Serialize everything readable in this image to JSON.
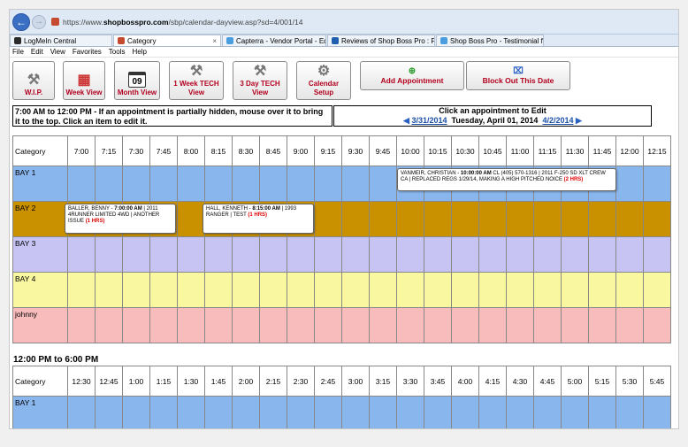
{
  "browser": {
    "url_prefix": "https://www.",
    "url_host": "shopbosspro.com",
    "url_path": "/sbp/calendar-dayview.asp?sd=4/001/14",
    "tabs": [
      {
        "label": "LogMeIn Central",
        "color": "#2b2b2b"
      },
      {
        "label": "Category",
        "color": "#c54a2f",
        "active": true
      },
      {
        "label": "Capterra - Vendor Portal - Edit...",
        "color": "#4a9ee0"
      },
      {
        "label": "Reviews of Shop Boss Pro : Fre...",
        "color": "#1f5fb0"
      },
      {
        "label": "Shop Boss Pro - Testimonial fr...",
        "color": "#4a9ee0"
      }
    ],
    "menu": [
      "File",
      "Edit",
      "View",
      "Favorites",
      "Tools",
      "Help"
    ]
  },
  "toolbar": {
    "wip": "W.I.P.",
    "week_view": "Week View",
    "month_view": "Month View",
    "month_day": "09",
    "one_week_tech_1": "1 Week TECH",
    "one_week_tech_2": "View",
    "three_day_tech_1": "3 Day TECH",
    "three_day_tech_2": "View",
    "calendar_setup_1": "Calendar",
    "calendar_setup_2": "Setup",
    "add_appointment": "Add Appointment",
    "block_out": "Block Out This Date"
  },
  "info": {
    "left_text": "7:00 AM to 12:00 PM - If an appointment is partially hidden, mouse over it to bring it to the top.  Click an item to edit it.",
    "right_title": "Click an appointment to Edit",
    "prev_date": "3/31/2014",
    "current_date": "Tuesday, April 01, 2014",
    "next_date": "4/2/2014"
  },
  "grid1": {
    "category_label": "Category",
    "times": [
      "7:00",
      "7:15",
      "7:30",
      "7:45",
      "8:00",
      "8:15",
      "8:30",
      "8:45",
      "9:00",
      "9:15",
      "9:30",
      "9:45",
      "10:00",
      "10:15",
      "10:30",
      "10:45",
      "11:00",
      "11:15",
      "11:30",
      "11:45",
      "12:00",
      "12:15"
    ],
    "rows": [
      {
        "label": "BAY 1",
        "cls": "bay1"
      },
      {
        "label": "BAY 2",
        "cls": "bay2"
      },
      {
        "label": "BAY 3",
        "cls": "bay3"
      },
      {
        "label": "BAY 4",
        "cls": "bay4"
      },
      {
        "label": "johnny",
        "cls": "johnny"
      }
    ]
  },
  "appointments": [
    {
      "name": "VANMEIR, CHRISTIAN",
      "time": "10:00:00 AM",
      "rest": "CL (405) 570-1316  | 2011 F-250 SD XLT CREW CA | REPLACED REGS 1/29/14, MAKING A HIGH PITCHED NOICE",
      "hrs": "(2 HRS)"
    },
    {
      "name": "BALLER, BENNY",
      "time": "7:00:00 AM",
      "rest": "| 2011 4RUNNER LIMITED 4WD | ANOTHER ISSUE",
      "hrs": "(1 HRS)"
    },
    {
      "name": "HALL, KENNETH",
      "time": "8:15:00 AM",
      "rest": "| 1993 RANGER | TEST",
      "hrs": "(1 HRS)"
    }
  ],
  "section2": {
    "title": "12:00 PM to 6:00 PM",
    "category_label": "Category",
    "times": [
      "12:30",
      "12:45",
      "1:00",
      "1:15",
      "1:30",
      "1:45",
      "2:00",
      "2:15",
      "2:30",
      "2:45",
      "3:00",
      "3:15",
      "3:30",
      "3:45",
      "4:00",
      "4:15",
      "4:30",
      "4:45",
      "5:00",
      "5:15",
      "5:30",
      "5:45"
    ],
    "rows": [
      {
        "label": "BAY 1",
        "cls": "bay1"
      }
    ]
  }
}
